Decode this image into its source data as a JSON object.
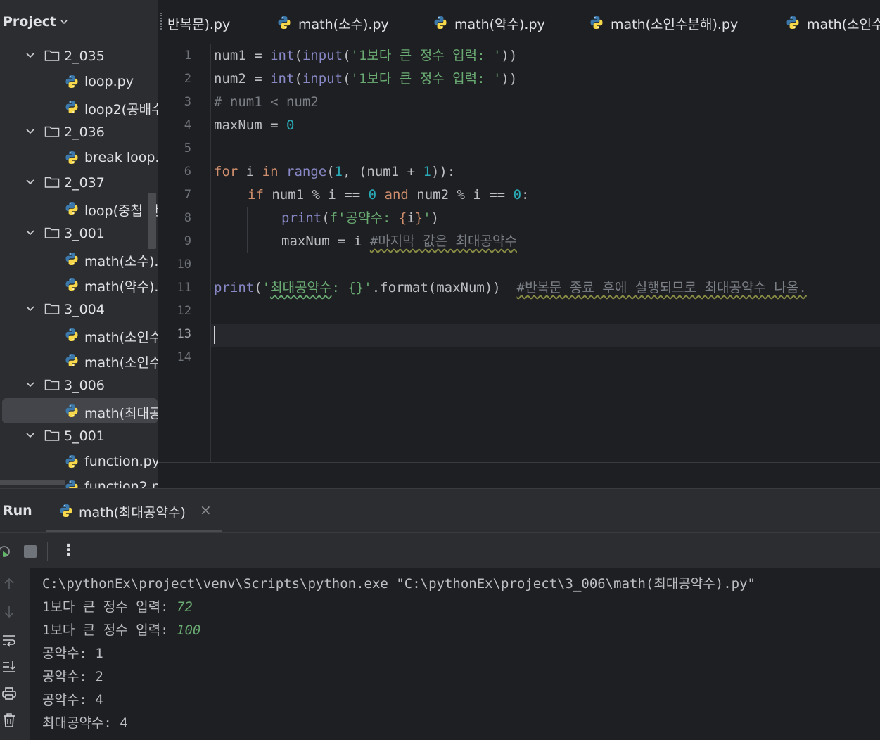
{
  "project": {
    "title": "Project",
    "tree": [
      {
        "type": "folder",
        "label": "2_035"
      },
      {
        "type": "file",
        "label": "loop.py"
      },
      {
        "type": "file",
        "label": "loop2(공배수"
      },
      {
        "type": "folder",
        "label": "2_036"
      },
      {
        "type": "file",
        "label": "break loop."
      },
      {
        "type": "folder",
        "label": "2_037"
      },
      {
        "type": "file",
        "label": "loop(중첩 반"
      },
      {
        "type": "folder",
        "label": "3_001"
      },
      {
        "type": "file",
        "label": "math(소수)."
      },
      {
        "type": "file",
        "label": "math(약수)."
      },
      {
        "type": "folder",
        "label": "3_004"
      },
      {
        "type": "file",
        "label": "math(소인수"
      },
      {
        "type": "file",
        "label": "math(소인수"
      },
      {
        "type": "folder",
        "label": "3_006"
      },
      {
        "type": "file",
        "label": "math(최대공",
        "selected": true
      },
      {
        "type": "folder",
        "label": "5_001"
      },
      {
        "type": "file",
        "label": "function.py"
      },
      {
        "type": "file",
        "label": "function2.p"
      }
    ]
  },
  "tabs": [
    {
      "label": "반복문).py",
      "icon": "python-file-icon"
    },
    {
      "label": "math(소수).py",
      "icon": "python-file-icon"
    },
    {
      "label": "math(약수).py",
      "icon": "python-file-icon"
    },
    {
      "label": "math(소인수분해).py",
      "icon": "python-file-icon"
    },
    {
      "label": "math(소인수",
      "icon": "python-file-icon"
    }
  ],
  "editor": {
    "line_numbers": [
      "1",
      "2",
      "3",
      "4",
      "5",
      "6",
      "7",
      "8",
      "9",
      "10",
      "11",
      "12",
      "13",
      "14"
    ],
    "current_line": "13",
    "code": {
      "l1": {
        "a": "num1 = ",
        "b": "int",
        "c": "(",
        "d": "input",
        "e": "(",
        "f": "'1보다 큰 정수 입력: '",
        "g": "))"
      },
      "l2": {
        "a": "num2 = ",
        "b": "int",
        "c": "(",
        "d": "input",
        "e": "(",
        "f": "'1보다 큰 정수 입력: '",
        "g": "))"
      },
      "l3": {
        "a": "# num1 < num2"
      },
      "l4": {
        "a": "maxNum = ",
        "b": "0"
      },
      "l6": {
        "a": "for",
        "b": " i ",
        "c": "in",
        "d": " ",
        "e": "range",
        "f": "(",
        "g": "1",
        "h": ", (num1 + ",
        "i": "1",
        "j": ")):"
      },
      "l7": {
        "a": "if",
        "b": " num1 % i == ",
        "c": "0",
        "d": " ",
        "e": "and",
        "f": " num2 % i == ",
        "g": "0",
        "h": ":"
      },
      "l8": {
        "a": "print",
        "b": "(",
        "c": "f'공약수: ",
        "d": "{",
        "e": "i",
        "f": "}",
        "g": "'",
        "h": ")"
      },
      "l9": {
        "a": "maxNum = i ",
        "b": "#마지막 값은 최대공약수"
      },
      "l11": {
        "a": "print",
        "b": "(",
        "c": "'",
        "d": "최대공약수",
        "e": ": {}'",
        "f": ".format(maxNum))  ",
        "g": "#반복문 종료 후에 실행되므로 최대공약수 나옴."
      }
    }
  },
  "run": {
    "title": "Run",
    "tab_label": "math(최대공약수)",
    "close_glyph": "×",
    "more_glyph": "⋮",
    "console": {
      "command": "C:\\pythonEx\\project\\venv\\Scripts\\python.exe \"C:\\pythonEx\\project\\3_006\\math(최대공약수).py\"",
      "prompt1": "1보다 큰 정수 입력: ",
      "input1": "72",
      "prompt2": "1보다 큰 정수 입력: ",
      "input2": "100",
      "out1": "공약수: 1",
      "out2": "공약수: 2",
      "out3": "공약수: 4",
      "out4": "최대공약수: 4"
    }
  },
  "colors": {
    "keyword": "#cf8e6d",
    "builtin": "#8888c6",
    "string": "#6aab73",
    "number": "#2aacb8",
    "comment": "#7a7e85",
    "function": "#56a8f5",
    "python_blue": "#3c78aa",
    "python_yellow": "#f7d84a"
  }
}
